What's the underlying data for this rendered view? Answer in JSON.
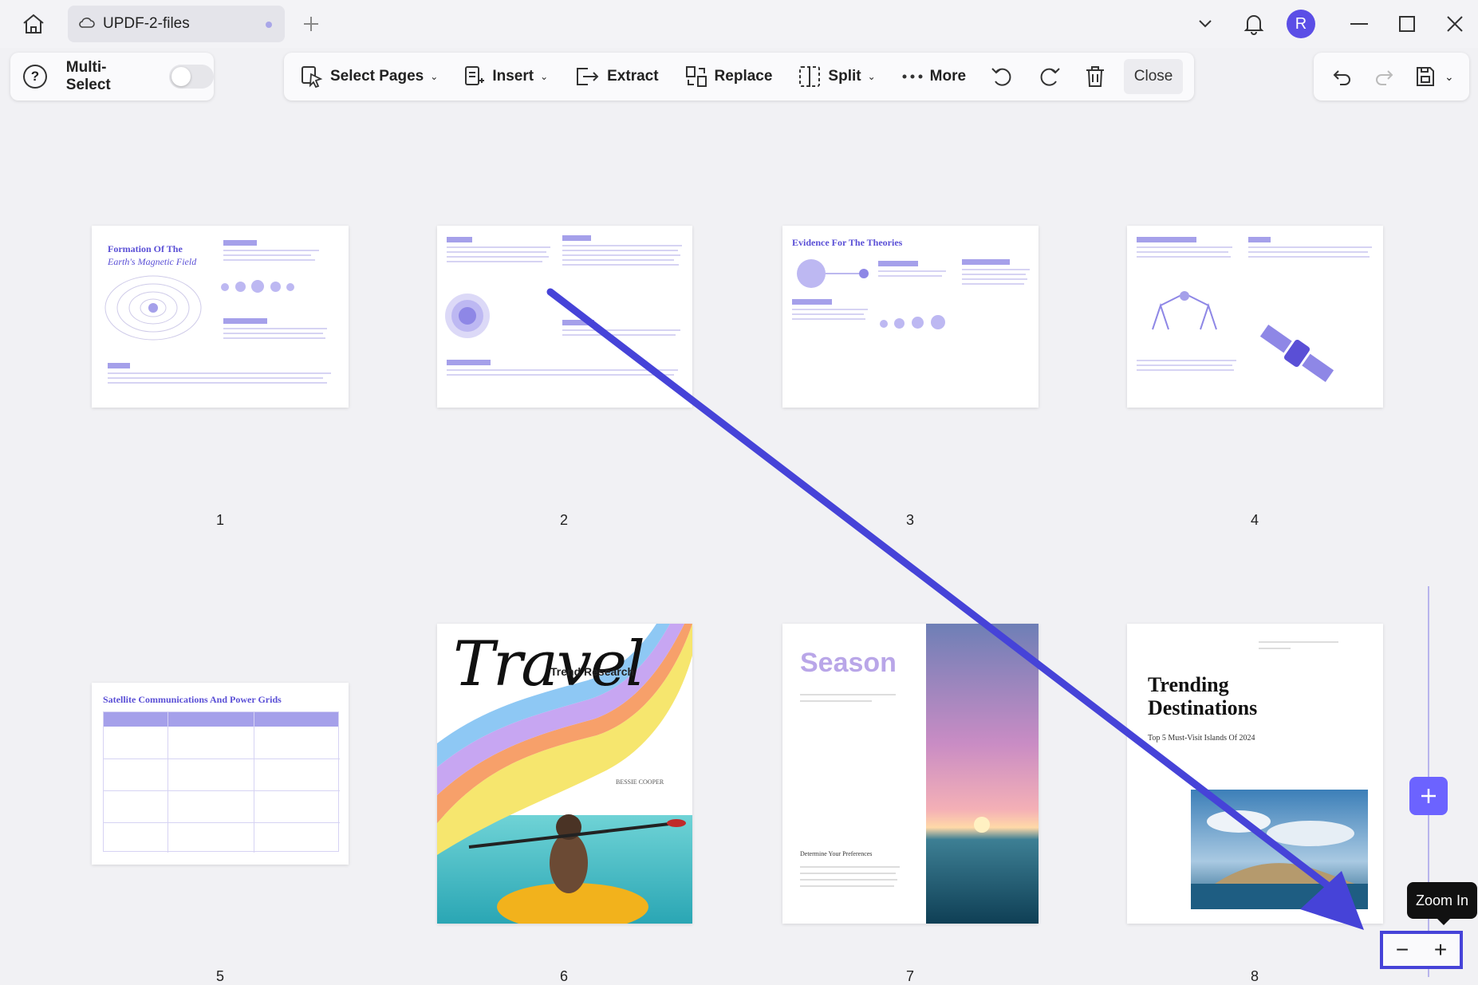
{
  "titlebar": {
    "tab_title": "UPDF-2-files",
    "avatar_initial": "R"
  },
  "toolbar": {
    "multi_select_label": "Multi-Select",
    "multi_select_on": false,
    "select_pages_label": "Select Pages",
    "insert_label": "Insert",
    "extract_label": "Extract",
    "replace_label": "Replace",
    "split_label": "Split",
    "more_label": "More",
    "close_label": "Close"
  },
  "pages": [
    {
      "number": "1",
      "title": "Formation Of The",
      "subtitle": "Earth's Magnetic Field"
    },
    {
      "number": "2"
    },
    {
      "number": "3",
      "title": "Evidence For The Theories"
    },
    {
      "number": "4"
    },
    {
      "number": "5",
      "title": "Satellite Communications And Power Grids"
    },
    {
      "number": "6",
      "title": "Travel",
      "subtitle": "Trend Research",
      "author": "BESSIE COOPER"
    },
    {
      "number": "7",
      "title": "Season",
      "subtitle": "Determine Your Preferences"
    },
    {
      "number": "8",
      "title": "Trending Destinations",
      "subtitle": "Top 5 Must-Visit Islands Of 2024"
    }
  ],
  "zoom": {
    "tooltip": "Zoom In",
    "minus": "−",
    "plus": "+"
  },
  "colors": {
    "accent": "#6c63ff",
    "annotation_arrow": "#4643d8",
    "doc_purple": "#5a4fd6"
  }
}
